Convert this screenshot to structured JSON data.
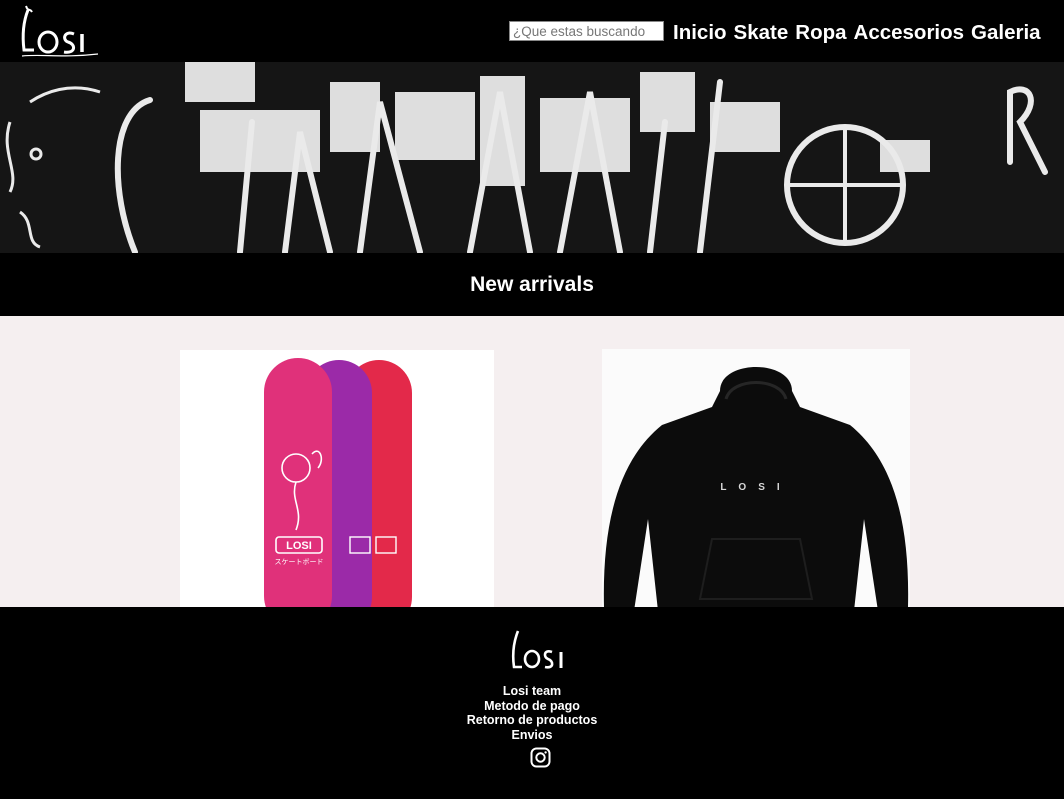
{
  "header": {
    "logo_text": "Losi",
    "search": {
      "placeholder": "¿Que estas buscando",
      "value": ""
    },
    "nav": [
      {
        "label": "Inicio"
      },
      {
        "label": "Skate"
      },
      {
        "label": "Ropa"
      },
      {
        "label": "Accesorios"
      },
      {
        "label": "Galeria"
      }
    ]
  },
  "section": {
    "title": "New arrivals"
  },
  "products": [
    {
      "image": "skateboard-decks-icon",
      "deck_brand": "LOSI",
      "deck_subtitle": "スケートボード",
      "deck_colors": [
        "#e0317a",
        "#9b2aa8",
        "#e3294a"
      ]
    },
    {
      "image": "black-hoodie-icon",
      "print_text": "LOSI",
      "color": "#0c0c0c"
    }
  ],
  "footer": {
    "logo_text": "Losi",
    "links": [
      "Losi team",
      "Metodo de pago",
      "Retorno de productos",
      "Envios"
    ],
    "social": "instagram-icon"
  },
  "colors": {
    "header_bg": "#000000",
    "products_bg": "#f5eff0",
    "text": "#ffffff"
  }
}
